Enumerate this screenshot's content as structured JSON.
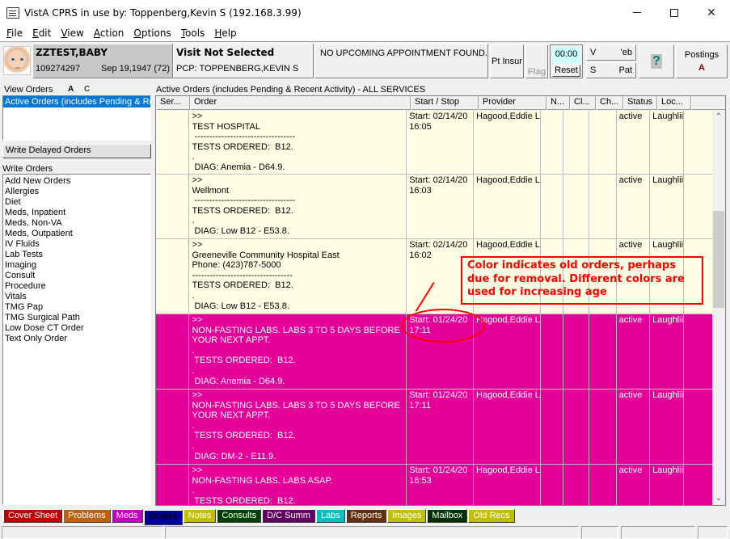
{
  "window": {
    "title": "VistA CPRS in use by: Toppenberg,Kevin S  (192.168.3.99)",
    "app_icon": "cprs-app-icon",
    "controls": {
      "minimize": "minimize-icon",
      "maximize": "maximize-icon",
      "close": "✕"
    }
  },
  "menu": [
    {
      "label": "File",
      "accel": "F",
      "rest": "ile"
    },
    {
      "label": "Edit",
      "accel": "E",
      "rest": "dit"
    },
    {
      "label": "View",
      "accel": "V",
      "rest": "iew"
    },
    {
      "label": "Action",
      "accel": "A",
      "rest": "ction"
    },
    {
      "label": "Options",
      "accel": "O",
      "rest": "ptions"
    },
    {
      "label": "Tools",
      "accel": "T",
      "rest": "ools"
    },
    {
      "label": "Help",
      "accel": "H",
      "rest": "elp"
    }
  ],
  "header": {
    "patient": {
      "name": "ZZTEST,BABY",
      "id": "109274297",
      "dob": "Sep 19,1947 (72)"
    },
    "visit": {
      "title": "Visit Not Selected",
      "pcp": "PCP:  TOPPENBERG,KEVIN S"
    },
    "appointment": "NO UPCOMING APPOINTMENT FOUND.",
    "pt_insur": "Pt Insur",
    "flag": "Flag",
    "timer": {
      "value": "00:00",
      "reset": "Reset"
    },
    "vw_left": "V",
    "vw_right": "'eb",
    "sp_left": "S",
    "sp_right": "Pat",
    "help": "?",
    "postings": {
      "label": "Postings",
      "flag": "A"
    }
  },
  "left_panel": {
    "view_orders_label": "View Orders",
    "flag_a": "A",
    "flag_c": "C",
    "view_selected": "Active Orders (includes Pending & Recent Activity)",
    "write_delayed": "Write Delayed Orders",
    "write_orders_label": "Write Orders",
    "write_items": [
      "Add New Orders",
      "Allergies",
      "Diet",
      "Meds, Inpatient",
      "Meds, Non-VA",
      "Meds, Outpatient",
      "IV Fluids",
      "Lab Tests",
      "Imaging",
      "Consult",
      "Procedure",
      "Vitals",
      "TMG Pap",
      "TMG Surgical Path",
      "Low Dose CT Order",
      "Text Only Order"
    ]
  },
  "orders": {
    "title": "Active Orders (includes Pending & Recent Activity) - ALL SERVICES",
    "columns": [
      "Ser...",
      "Order",
      "Start / Stop",
      "Provider",
      "N...",
      "Cl...",
      "Ch...",
      "Status",
      "Loc..."
    ],
    "rows": [
      {
        "age": "recent",
        "service": "",
        "order": ">>\nTEST HOSPITAL\n ----------------------------------\nTESTS ORDERED:  B12.\n.\n DIAG: Anemia - D64.9.",
        "start": "Start: 02/14/20\n16:05",
        "provider": "Hagood,Eddie L",
        "status": "active",
        "location": "Laughlii"
      },
      {
        "age": "recent",
        "service": "",
        "order": ">>\nWellmont\n ----------------------------------\nTESTS ORDERED:  B12.\n.\n DIAG: Low B12 - E53.8.",
        "start": "Start: 02/14/20\n16:03",
        "provider": "Hagood,Eddie L",
        "status": "active",
        "location": "Laughlii"
      },
      {
        "age": "recent",
        "service": "",
        "order": ">>\nGreeneville Community Hospital East\nPhone: (423)787-5000\n----------------------------------\nTESTS ORDERED:  B12.\n.\n DIAG: Low B12 - E53.8.",
        "start": "Start: 02/14/20\n16:02",
        "provider": "Hagood,Eddie L",
        "status": "active",
        "location": "Laughlii"
      },
      {
        "age": "old",
        "service": "",
        "order": ">>\nNON-FASTING LABS. LABS 3 TO 5 DAYS BEFORE\nYOUR NEXT APPT.\n.\n TESTS ORDERED:  B12.\n.\n DIAG: Anemia - D64.9.",
        "start": "Start: 01/24/20\n17:11",
        "provider": "Hagood,Eddie L",
        "status": "active",
        "location": "Laughlii"
      },
      {
        "age": "old",
        "service": "",
        "order": ">>\nNON-FASTING LABS. LABS 3 TO 5 DAYS BEFORE\nYOUR NEXT APPT.\n.\n TESTS ORDERED:  B12.\n.\n DIAG: DM-2 - E11.9.",
        "start": "Start: 01/24/20\n17:11",
        "provider": "Hagood,Eddie L",
        "status": "active",
        "location": "Laughlii"
      },
      {
        "age": "old",
        "service": "",
        "order": ">>\nNON-FASTING LABS. LABS ASAP.\n.\n TESTS ORDERED:  B12.",
        "start": "Start: 01/24/20\n16:53",
        "provider": "Hagood,Eddie L",
        "status": "active",
        "location": "Laughlii"
      }
    ],
    "row_colors": {
      "recent": "#ffffe6",
      "old": "#e6009a"
    }
  },
  "annotation": {
    "text": "Color indicates old orders, perhaps due for removal.  Different colors are used for increasing age",
    "color": "#ff0000"
  },
  "tabs": [
    {
      "label": "Cover Sheet",
      "bg": "#c00000",
      "fg": "#ffffff"
    },
    {
      "label": "Problems",
      "bg": "#c06010",
      "fg": "#ffffff"
    },
    {
      "label": "Meds",
      "bg": "#c000c0",
      "fg": "#ffffff"
    },
    {
      "label": "Orders",
      "bg": "#0000a0",
      "fg": "#000000",
      "active": true
    },
    {
      "label": "Notes",
      "bg": "#c0c000",
      "fg": "#ffffff"
    },
    {
      "label": "Consults",
      "bg": "#004000",
      "fg": "#ffffff"
    },
    {
      "label": "D/C Summ",
      "bg": "#600060",
      "fg": "#ffffff"
    },
    {
      "label": "Labs",
      "bg": "#00c0c0",
      "fg": "#ffffff"
    },
    {
      "label": "Reports",
      "bg": "#603010",
      "fg": "#ffffff"
    },
    {
      "label": "Images",
      "bg": "#c0c000",
      "fg": "#ffffff"
    },
    {
      "label": "Mailbox",
      "bg": "#003000",
      "fg": "#ffffff"
    },
    {
      "label": "Old Recs",
      "bg": "#c0c000",
      "fg": "#ffffff"
    }
  ]
}
